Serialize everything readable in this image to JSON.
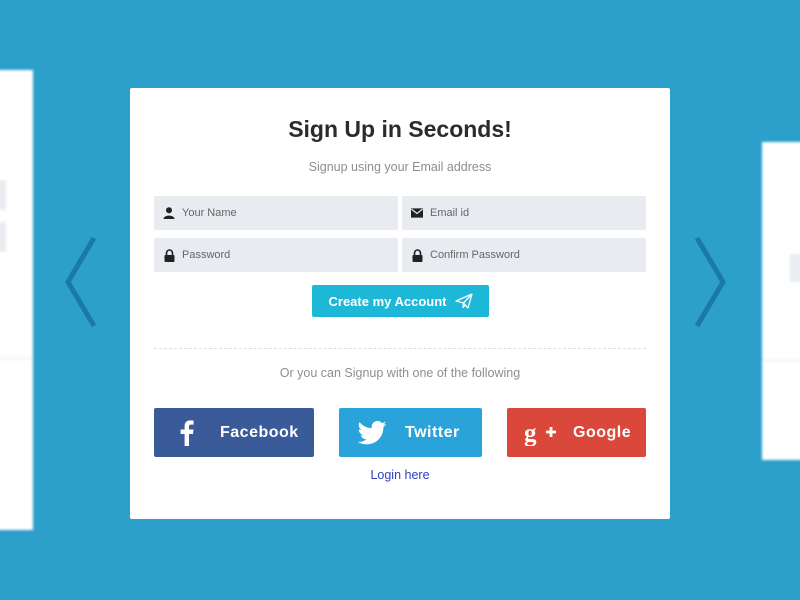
{
  "colors": {
    "background": "#2c9fcb",
    "create_button": "#1db7d8",
    "facebook": "#3b5a99",
    "twitter": "#2aa3db",
    "google": "#d9483b",
    "arrow": "#1b79a8",
    "login_link": "#2b3fbf"
  },
  "signup": {
    "title": "Sign Up in Seconds!",
    "subtitle": "Signup using your Email address",
    "fields": {
      "name": {
        "placeholder": "Your Name",
        "icon": "user-icon"
      },
      "email": {
        "placeholder": "Email id",
        "icon": "envelope-icon"
      },
      "password": {
        "placeholder": "Password",
        "icon": "lock-icon"
      },
      "confirm_password": {
        "placeholder": "Confirm Password",
        "icon": "lock-icon"
      }
    },
    "create_button": {
      "label": "Create my Account",
      "icon": "paper-plane-icon"
    },
    "social_prompt": "Or you can Signup with one of the following",
    "social": {
      "facebook": {
        "label": "Facebook",
        "icon": "facebook-icon"
      },
      "twitter": {
        "label": "Twitter",
        "icon": "twitter-icon"
      },
      "google": {
        "label": "Google",
        "icon": "google-plus-icon"
      }
    },
    "login_link": "Login here"
  },
  "carousel": {
    "prev_icon": "chevron-left-icon",
    "next_icon": "chevron-right-icon"
  }
}
